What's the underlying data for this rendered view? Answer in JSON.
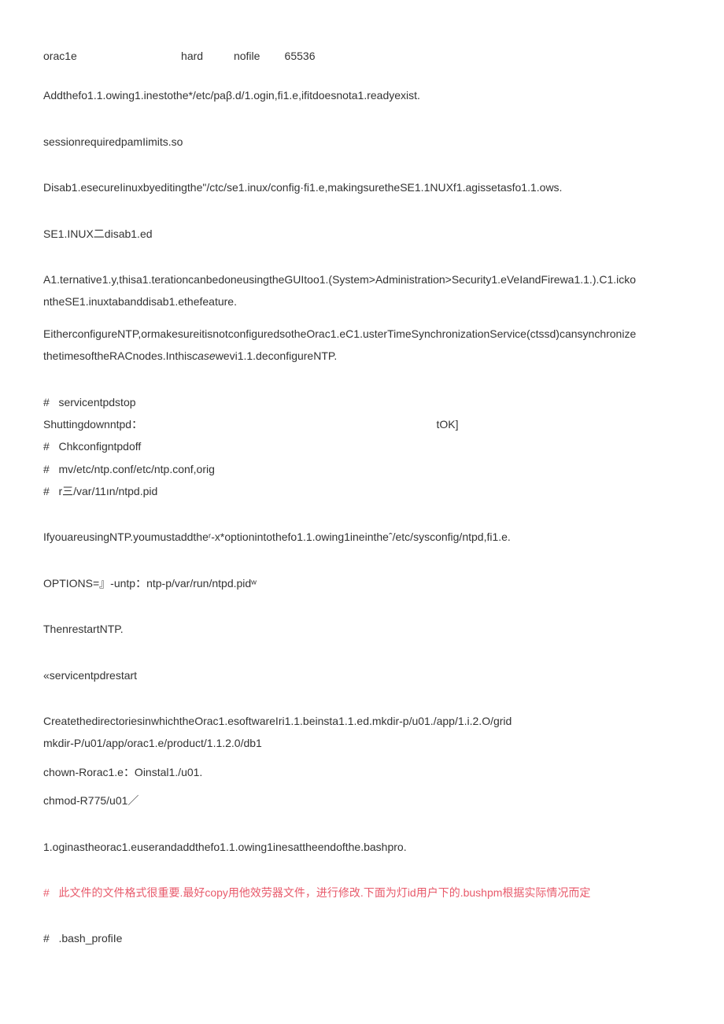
{
  "lines": {
    "l01": "orac1e                                  hard          nofile        65536",
    "l02": "Addthefo1.1.owing1.inestothe*/etc/paβ.d/1.ogin,fi1.e,ifitdoesnota1.readyexist.",
    "l03": "sessionrequiredpamIimits.so",
    "l04": "Disab1.esecureIinuxbyeditingthe\"/ctc/se1.inux/config·fi1.e,makingsuretheSE1.1NUXf1.agissetasfo1.1.ows.",
    "l05": "SE1.INUX二disab1.ed",
    "l06a": "A1.ternative1.y,thisa1.terationcanbedoneusingtheGUItoo1.(System>Administration>Security1.eVeIandFirewa1.1.).C1.icko",
    "l06b": "ntheSE1.inuxtabanddisab1.ethefeature.",
    "l07a": "EitherconfigureNTP,ormakesureitisnotconfiguredsotheOrac1.eC1.usterTimeSynchronizationService(ctssd)cansynchronize",
    "l07b_prefix": "thetimesoftheRACnodes.Inthis",
    "l07b_italic": "case",
    "l07b_suffix": "wevi1.1.deconfigureNTP.",
    "l08": "servicentpdstop",
    "l09": "Shuttingdownntpd：                                                                                                tOK]",
    "l10": "Chkconfigntpdoff",
    "l11": "mv/etc/ntp.conf/etc/ntp.conf,orig",
    "l12": "r三/var/11ın/ntpd.pid",
    "l13": "IfyouareusingNTP.youmustaddtheʳ-x*optionintothefo1.1.owing1ineintheˆ/etc/sysconfig/ntpd,fi1.e.",
    "l14": "OPTIONS=』-untp：ntp-p/var/run/ntpd.pidʷ",
    "l15": "ThenrestartNTP.",
    "l16": "«servicentpdrestart",
    "l17a": "CreatethedirectoriesinwhichtheOrac1.esoftwareIri1.1.beinsta1.1.ed.mkdir-p/u01./app/1.i.2.O/grid",
    "l17b": "mkdir-P/u01/app/orac1.e/product/1.1.2.0/db1",
    "l18": "chown-Rorac1.e：Oinstal1./u01.",
    "l19": "chmod-R775/u01／",
    "l20": "1.oginastheorac1.euserandaddthefo1.1.owing1inesattheendofthe.bashpro.",
    "l21": "此文件的文件格式很重要.最好copy用他效劳器文件，进行修改.下面为灯id用户下的.bushpm根据实际情况而定",
    "l22": ".bash_profiIe"
  }
}
